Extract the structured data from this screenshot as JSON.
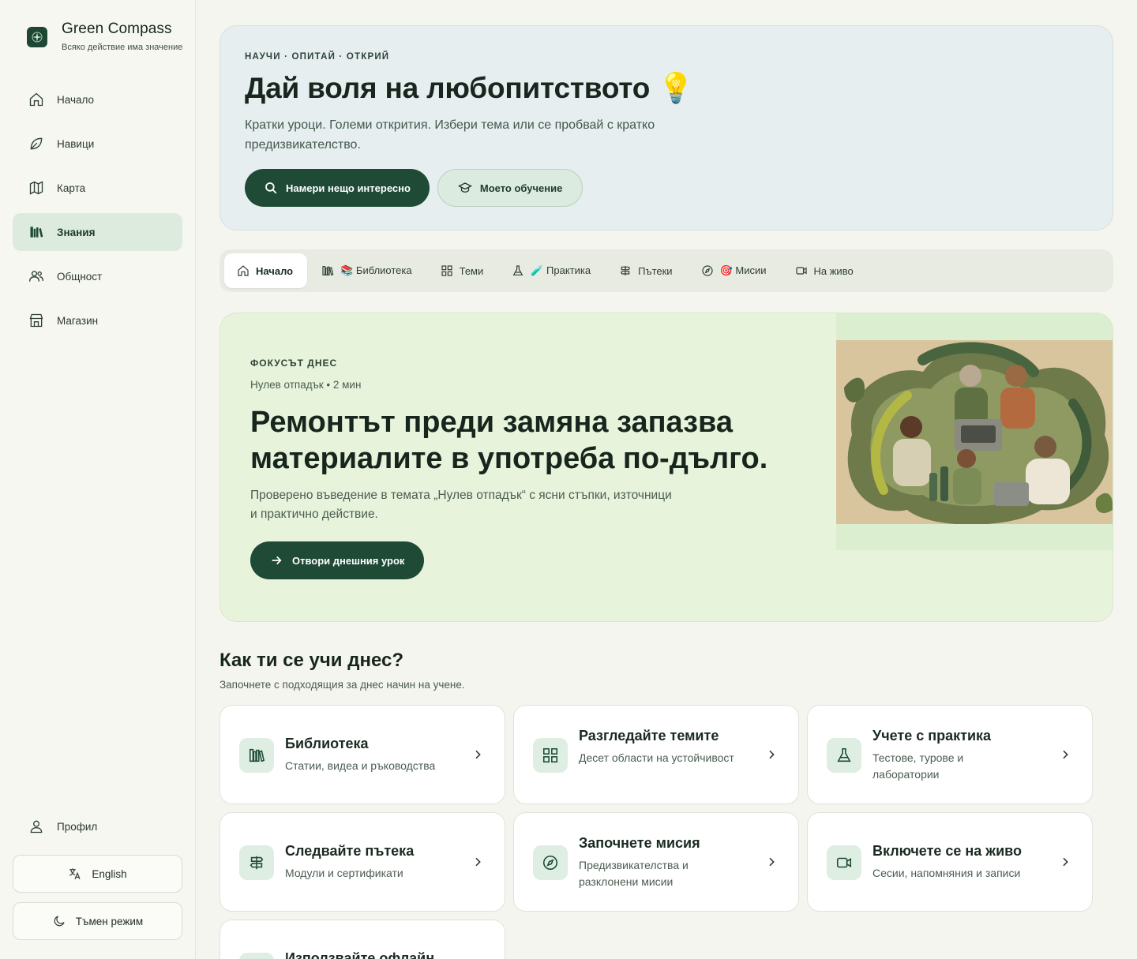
{
  "brand": {
    "title": "Green Compass",
    "tagline": "Всяко действие има значение"
  },
  "sidebar": {
    "items": [
      {
        "label": "Начало",
        "icon": "home-icon"
      },
      {
        "label": "Навици",
        "icon": "leaf-icon"
      },
      {
        "label": "Карта",
        "icon": "map-icon"
      },
      {
        "label": "Знания",
        "icon": "library-icon",
        "active": true
      },
      {
        "label": "Общност",
        "icon": "users-icon"
      },
      {
        "label": "Магазин",
        "icon": "store-icon"
      }
    ],
    "profile": "Профил",
    "language": "English",
    "dark_mode": "Тъмен режим"
  },
  "hero": {
    "eyebrow": "НАУЧИ · ОПИТАЙ · ОТКРИЙ",
    "title": "Дай воля на любопитството 💡",
    "description": "Кратки уроци. Големи открития. Избери тема или се пробвай с кратко предизвикателство.",
    "primary_button": "Намери нещо интересно",
    "secondary_button": "Моето обучение"
  },
  "tabs": [
    {
      "label": "Начало",
      "active": true
    },
    {
      "label": "📚 Библиотека"
    },
    {
      "label": "Теми"
    },
    {
      "label": "🧪 Практика"
    },
    {
      "label": "Пътеки"
    },
    {
      "label": "🎯 Мисии"
    },
    {
      "label": "На живо"
    }
  ],
  "focus": {
    "eyebrow": "ФОКУСЪТ ДНЕС",
    "meta": "Нулев отпадък • 2 мин",
    "title": "Ремонтът преди замяна запазва материалите в употреба по-дълго.",
    "description": "Проверено въведение в темата „Нулев отпадък“ с ясни стъпки, източници и практично действие.",
    "button": "Отвори днешния урок"
  },
  "learn": {
    "title": "Как ти се учи днес?",
    "subtitle": "Започнете с подходящия за днес начин на учене.",
    "cards": [
      {
        "title": "Библиотека",
        "desc": "Статии, видеа и ръководства",
        "icon": "library-icon"
      },
      {
        "title": "Разгледайте темите",
        "desc": "Десет области на устойчивост",
        "icon": "grid-icon"
      },
      {
        "title": "Учете с практика",
        "desc": "Тестове, турове и лаборатории",
        "icon": "flask-icon"
      },
      {
        "title": "Следвайте пътека",
        "desc": "Модули и сертификати",
        "icon": "signpost-icon"
      },
      {
        "title": "Започнете мисия",
        "desc": "Предизвикателства и разклонени мисии",
        "icon": "compass-icon"
      },
      {
        "title": "Включете се на живо",
        "desc": "Сесии, напомняния и записи",
        "icon": "video-icon"
      },
      {
        "title": "Използвайте офлайн",
        "desc": "",
        "icon": "download-icon"
      }
    ]
  },
  "colors": {
    "accent": "#1e4a36",
    "sidebar_active": "#dcebde",
    "hero_bg": "#e6eef0",
    "focus_bg": "#e8f3dc"
  }
}
